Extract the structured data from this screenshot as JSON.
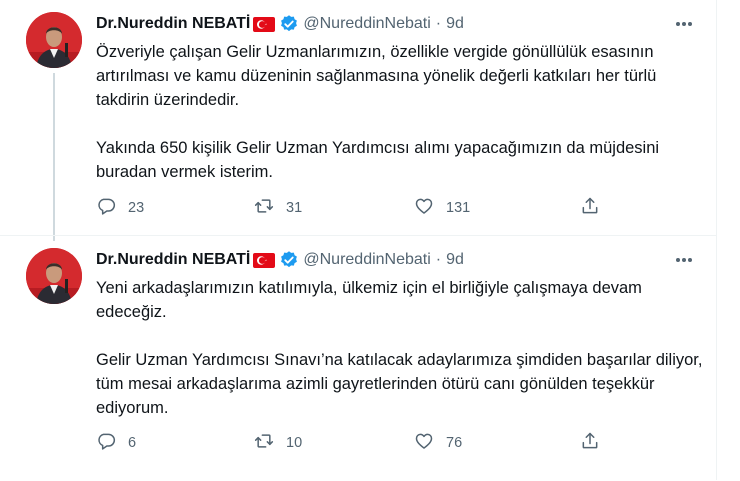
{
  "tweets": [
    {
      "author": {
        "name": "Dr.Nureddin NEBATİ",
        "handle": "@NureddinNebati"
      },
      "time": "9d",
      "paragraphs": [
        "Özveriyle çalışan Gelir Uzmanlarımızın, özellikle vergide gönüllülük esasının artırılması ve kamu düzeninin sağlanmasına yönelik değerli katkıları her türlü takdirin üzerindedir.",
        "Yakında 650 kişilik Gelir Uzman Yardımcısı alımı yapacağımızın da müjdesini buradan vermek isterim."
      ],
      "stats": {
        "replies": "23",
        "retweets": "31",
        "likes": "131"
      }
    },
    {
      "author": {
        "name": "Dr.Nureddin NEBATİ",
        "handle": "@NureddinNebati"
      },
      "time": "9d",
      "paragraphs": [
        "Yeni arkadaşlarımızın katılımıyla, ülkemiz için el birliğiyle çalışmaya devam edeceğiz.",
        "Gelir Uzman Yardımcısı Sınavı’na katılacak adaylarımıza şimdiden başarılar diliyor, tüm mesai arkadaşlarıma azimli gayretlerinden ötürü canı gönülden teşekkür ediyorum."
      ],
      "stats": {
        "replies": "6",
        "retweets": "10",
        "likes": "76"
      }
    }
  ],
  "ui": {
    "dot": "·"
  },
  "colors": {
    "text": "#0f1419",
    "secondary": "#536471",
    "verified": "#1d9bf0",
    "flag": "#e30a17",
    "thread_line": "#cfd9de"
  },
  "icons": [
    "avatar",
    "turkey-flag-icon",
    "verified-badge-icon",
    "more-icon",
    "reply-icon",
    "retweet-icon",
    "like-icon",
    "share-icon"
  ]
}
